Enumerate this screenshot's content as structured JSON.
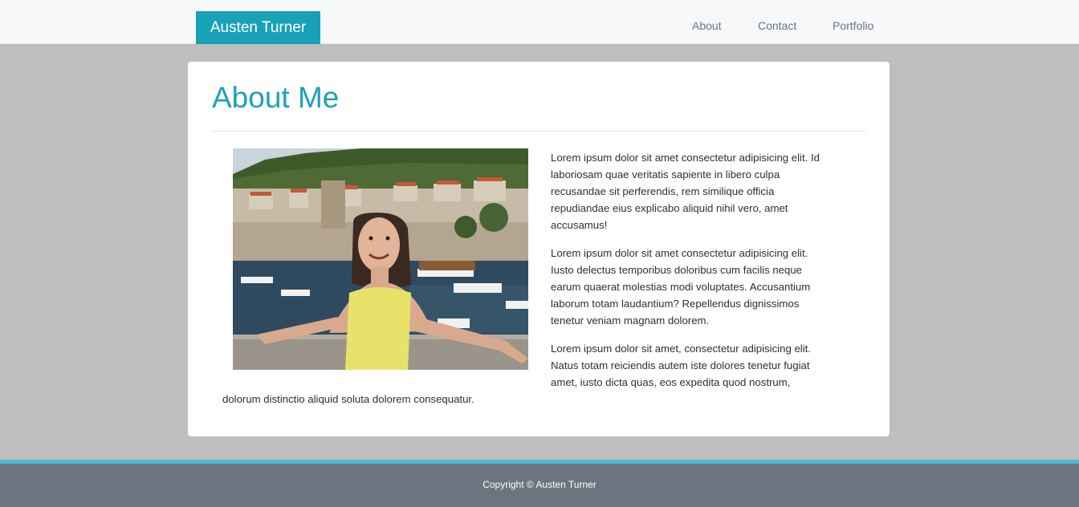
{
  "nav": {
    "brand": "Austen Turner",
    "links": [
      "About",
      "Contact",
      "Portfolio"
    ]
  },
  "main": {
    "title": "About Me",
    "photo_alt": "Woman in yellow top smiling in front of a harbor town",
    "paragraphs": [
      [
        "Lorem ipsum dolor sit amet consectetur adipisicing elit. Id",
        "laboriosam quae veritatis sapiente in libero culpa",
        "recusandae sit perferendis, rem similique officia",
        "repudiandae eius explicabo aliquid nihil vero, amet",
        "accusamus!"
      ],
      [
        "Lorem ipsum dolor sit amet consectetur adipisicing elit.",
        "Iusto delectus temporibus doloribus cum facilis neque",
        "earum quaerat molestias modi voluptates. Accusantium",
        "laborum totam laudantium? Repellendus dignissimos",
        "tenetur veniam magnam dolorem."
      ],
      [
        "Lorem ipsum dolor sit amet, consectetur adipisicing elit.",
        "Natus totam reiciendis autem iste dolores tenetur fugiat",
        "amet, iusto dicta quas, eos expedita quod nostrum,",
        "dolorum distinctio aliquid soluta dolorem consequatur."
      ]
    ]
  },
  "footer": {
    "copyright": "Copyright © Austen Turner"
  },
  "colors": {
    "brand": "#17a2b8",
    "title": "#1ea0b8",
    "page_bg": "#bfbdbe",
    "footer_bg": "#6c7480",
    "footer_accent": "#4bbad4"
  }
}
